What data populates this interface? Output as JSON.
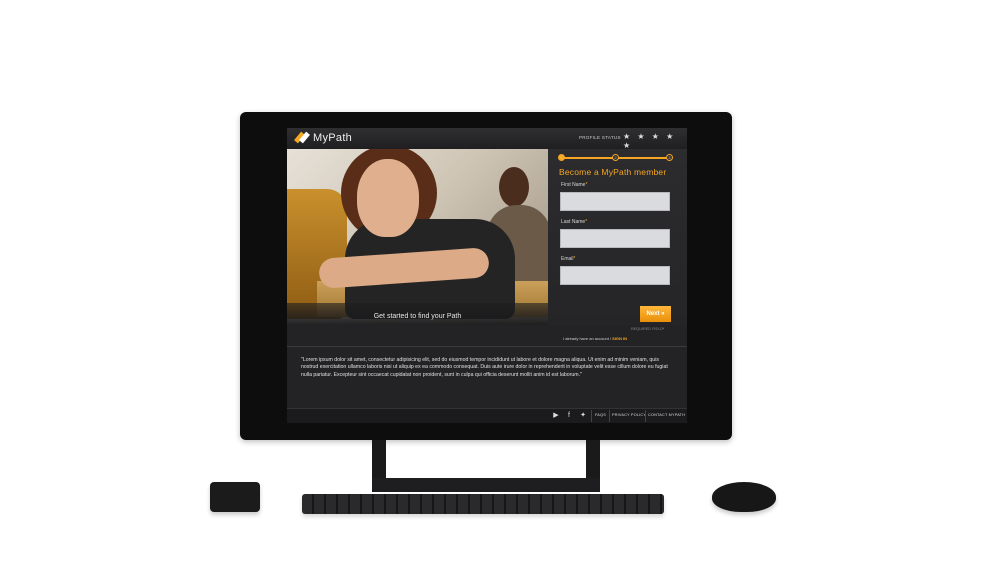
{
  "brand": {
    "name": "MyPath",
    "accent": "#f5a623"
  },
  "header": {
    "profile_status_label": "PROFILE STATUS",
    "stars": "★ ★ ★ ★ ★"
  },
  "hero": {
    "caption": "Get started to find your Path"
  },
  "form": {
    "steps": [
      "1",
      "2",
      "3"
    ],
    "title": "Become a MyPath member",
    "fields": [
      {
        "label": "First Name",
        "value": ""
      },
      {
        "label": "Last Name",
        "value": ""
      },
      {
        "label": "Email",
        "value": ""
      }
    ],
    "required_mark": "*",
    "next_label": "Next »",
    "required_note": "REQUIRED FIELD",
    "signin_prefix": "I already have an account / ",
    "signin_link": "SIGN IN"
  },
  "body_text": "\"Lorem ipsum dolor sit amet, consectetur adipisicing elit, sed do eiusmod tempor incididunt ut labore et dolore magna aliqua. Ut enim ad minim veniam, quis nostrud exercitation ullamco laboris nisi ut aliquip ex ea commodo consequat. Duis aute irure dolor in reprehenderit in voluptate velit esse cillum dolore eu fugiat nulla pariatur. Excepteur sint occaecat cupidatat non proident, sunt in culpa qui officia deserunt mollit anim id est laborum.\"",
  "footer": {
    "social": [
      {
        "icon": "youtube-icon",
        "glyph": "▶"
      },
      {
        "icon": "facebook-icon",
        "glyph": "f"
      },
      {
        "icon": "twitter-icon",
        "glyph": "✦"
      }
    ],
    "links": [
      "FAQS",
      "PRIVACY POLICY",
      "CONTACT MYPATH"
    ]
  }
}
